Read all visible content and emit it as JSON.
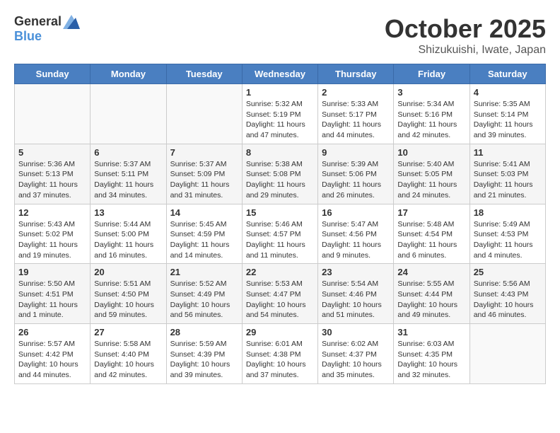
{
  "header": {
    "logo_general": "General",
    "logo_blue": "Blue",
    "month_title": "October 2025",
    "location": "Shizukuishi, Iwate, Japan"
  },
  "weekdays": [
    "Sunday",
    "Monday",
    "Tuesday",
    "Wednesday",
    "Thursday",
    "Friday",
    "Saturday"
  ],
  "weeks": [
    [
      {
        "day": "",
        "info": ""
      },
      {
        "day": "",
        "info": ""
      },
      {
        "day": "",
        "info": ""
      },
      {
        "day": "1",
        "info": "Sunrise: 5:32 AM\nSunset: 5:19 PM\nDaylight: 11 hours and 47 minutes."
      },
      {
        "day": "2",
        "info": "Sunrise: 5:33 AM\nSunset: 5:17 PM\nDaylight: 11 hours and 44 minutes."
      },
      {
        "day": "3",
        "info": "Sunrise: 5:34 AM\nSunset: 5:16 PM\nDaylight: 11 hours and 42 minutes."
      },
      {
        "day": "4",
        "info": "Sunrise: 5:35 AM\nSunset: 5:14 PM\nDaylight: 11 hours and 39 minutes."
      }
    ],
    [
      {
        "day": "5",
        "info": "Sunrise: 5:36 AM\nSunset: 5:13 PM\nDaylight: 11 hours and 37 minutes."
      },
      {
        "day": "6",
        "info": "Sunrise: 5:37 AM\nSunset: 5:11 PM\nDaylight: 11 hours and 34 minutes."
      },
      {
        "day": "7",
        "info": "Sunrise: 5:37 AM\nSunset: 5:09 PM\nDaylight: 11 hours and 31 minutes."
      },
      {
        "day": "8",
        "info": "Sunrise: 5:38 AM\nSunset: 5:08 PM\nDaylight: 11 hours and 29 minutes."
      },
      {
        "day": "9",
        "info": "Sunrise: 5:39 AM\nSunset: 5:06 PM\nDaylight: 11 hours and 26 minutes."
      },
      {
        "day": "10",
        "info": "Sunrise: 5:40 AM\nSunset: 5:05 PM\nDaylight: 11 hours and 24 minutes."
      },
      {
        "day": "11",
        "info": "Sunrise: 5:41 AM\nSunset: 5:03 PM\nDaylight: 11 hours and 21 minutes."
      }
    ],
    [
      {
        "day": "12",
        "info": "Sunrise: 5:43 AM\nSunset: 5:02 PM\nDaylight: 11 hours and 19 minutes."
      },
      {
        "day": "13",
        "info": "Sunrise: 5:44 AM\nSunset: 5:00 PM\nDaylight: 11 hours and 16 minutes."
      },
      {
        "day": "14",
        "info": "Sunrise: 5:45 AM\nSunset: 4:59 PM\nDaylight: 11 hours and 14 minutes."
      },
      {
        "day": "15",
        "info": "Sunrise: 5:46 AM\nSunset: 4:57 PM\nDaylight: 11 hours and 11 minutes."
      },
      {
        "day": "16",
        "info": "Sunrise: 5:47 AM\nSunset: 4:56 PM\nDaylight: 11 hours and 9 minutes."
      },
      {
        "day": "17",
        "info": "Sunrise: 5:48 AM\nSunset: 4:54 PM\nDaylight: 11 hours and 6 minutes."
      },
      {
        "day": "18",
        "info": "Sunrise: 5:49 AM\nSunset: 4:53 PM\nDaylight: 11 hours and 4 minutes."
      }
    ],
    [
      {
        "day": "19",
        "info": "Sunrise: 5:50 AM\nSunset: 4:51 PM\nDaylight: 11 hours and 1 minute."
      },
      {
        "day": "20",
        "info": "Sunrise: 5:51 AM\nSunset: 4:50 PM\nDaylight: 10 hours and 59 minutes."
      },
      {
        "day": "21",
        "info": "Sunrise: 5:52 AM\nSunset: 4:49 PM\nDaylight: 10 hours and 56 minutes."
      },
      {
        "day": "22",
        "info": "Sunrise: 5:53 AM\nSunset: 4:47 PM\nDaylight: 10 hours and 54 minutes."
      },
      {
        "day": "23",
        "info": "Sunrise: 5:54 AM\nSunset: 4:46 PM\nDaylight: 10 hours and 51 minutes."
      },
      {
        "day": "24",
        "info": "Sunrise: 5:55 AM\nSunset: 4:44 PM\nDaylight: 10 hours and 49 minutes."
      },
      {
        "day": "25",
        "info": "Sunrise: 5:56 AM\nSunset: 4:43 PM\nDaylight: 10 hours and 46 minutes."
      }
    ],
    [
      {
        "day": "26",
        "info": "Sunrise: 5:57 AM\nSunset: 4:42 PM\nDaylight: 10 hours and 44 minutes."
      },
      {
        "day": "27",
        "info": "Sunrise: 5:58 AM\nSunset: 4:40 PM\nDaylight: 10 hours and 42 minutes."
      },
      {
        "day": "28",
        "info": "Sunrise: 5:59 AM\nSunset: 4:39 PM\nDaylight: 10 hours and 39 minutes."
      },
      {
        "day": "29",
        "info": "Sunrise: 6:01 AM\nSunset: 4:38 PM\nDaylight: 10 hours and 37 minutes."
      },
      {
        "day": "30",
        "info": "Sunrise: 6:02 AM\nSunset: 4:37 PM\nDaylight: 10 hours and 35 minutes."
      },
      {
        "day": "31",
        "info": "Sunrise: 6:03 AM\nSunset: 4:35 PM\nDaylight: 10 hours and 32 minutes."
      },
      {
        "day": "",
        "info": ""
      }
    ]
  ]
}
